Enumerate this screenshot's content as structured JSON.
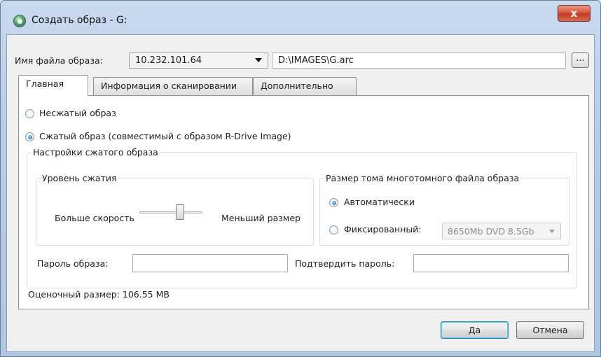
{
  "window": {
    "title": "Создать образ - G:",
    "close_label": "x"
  },
  "file": {
    "label": "Имя файла образа:",
    "server": "10.232.101.64",
    "path": "D:\\IMAGES\\G.arc",
    "browse_label": "..."
  },
  "tabs": [
    {
      "label": "Главная",
      "active": true
    },
    {
      "label": "Информация о сканировании",
      "active": false
    },
    {
      "label": "Дополнительно",
      "active": false
    }
  ],
  "main": {
    "uncompressed_label": "Несжатый образ",
    "compressed_label": "Сжатый образ (совместимый с образом R-Drive Image)",
    "compressed_settings_title": "Настройки сжатого образа",
    "compression": {
      "title": "Уровень сжатия",
      "left_label": "Больше скорость",
      "right_label": "Меньший размер",
      "level_fraction": 0.6
    },
    "volume": {
      "title": "Размер тома многотомного файла образа",
      "auto_label": "Автоматически",
      "fixed_label": "Фиксированный:",
      "fixed_value": "8650Mb DVD 8.5Gb"
    },
    "password_label": "Пароль образа:",
    "confirm_password_label": "Подтвердить пароль:",
    "estimate": "Оценочный размер: 106.55 MB"
  },
  "buttons": {
    "ok": "Да",
    "cancel": "Отмена"
  },
  "colors": {
    "titlebar": "#b9cde8",
    "close": "#c23a22",
    "panel": "#ffffff",
    "dialog": "#f0f0f0"
  }
}
